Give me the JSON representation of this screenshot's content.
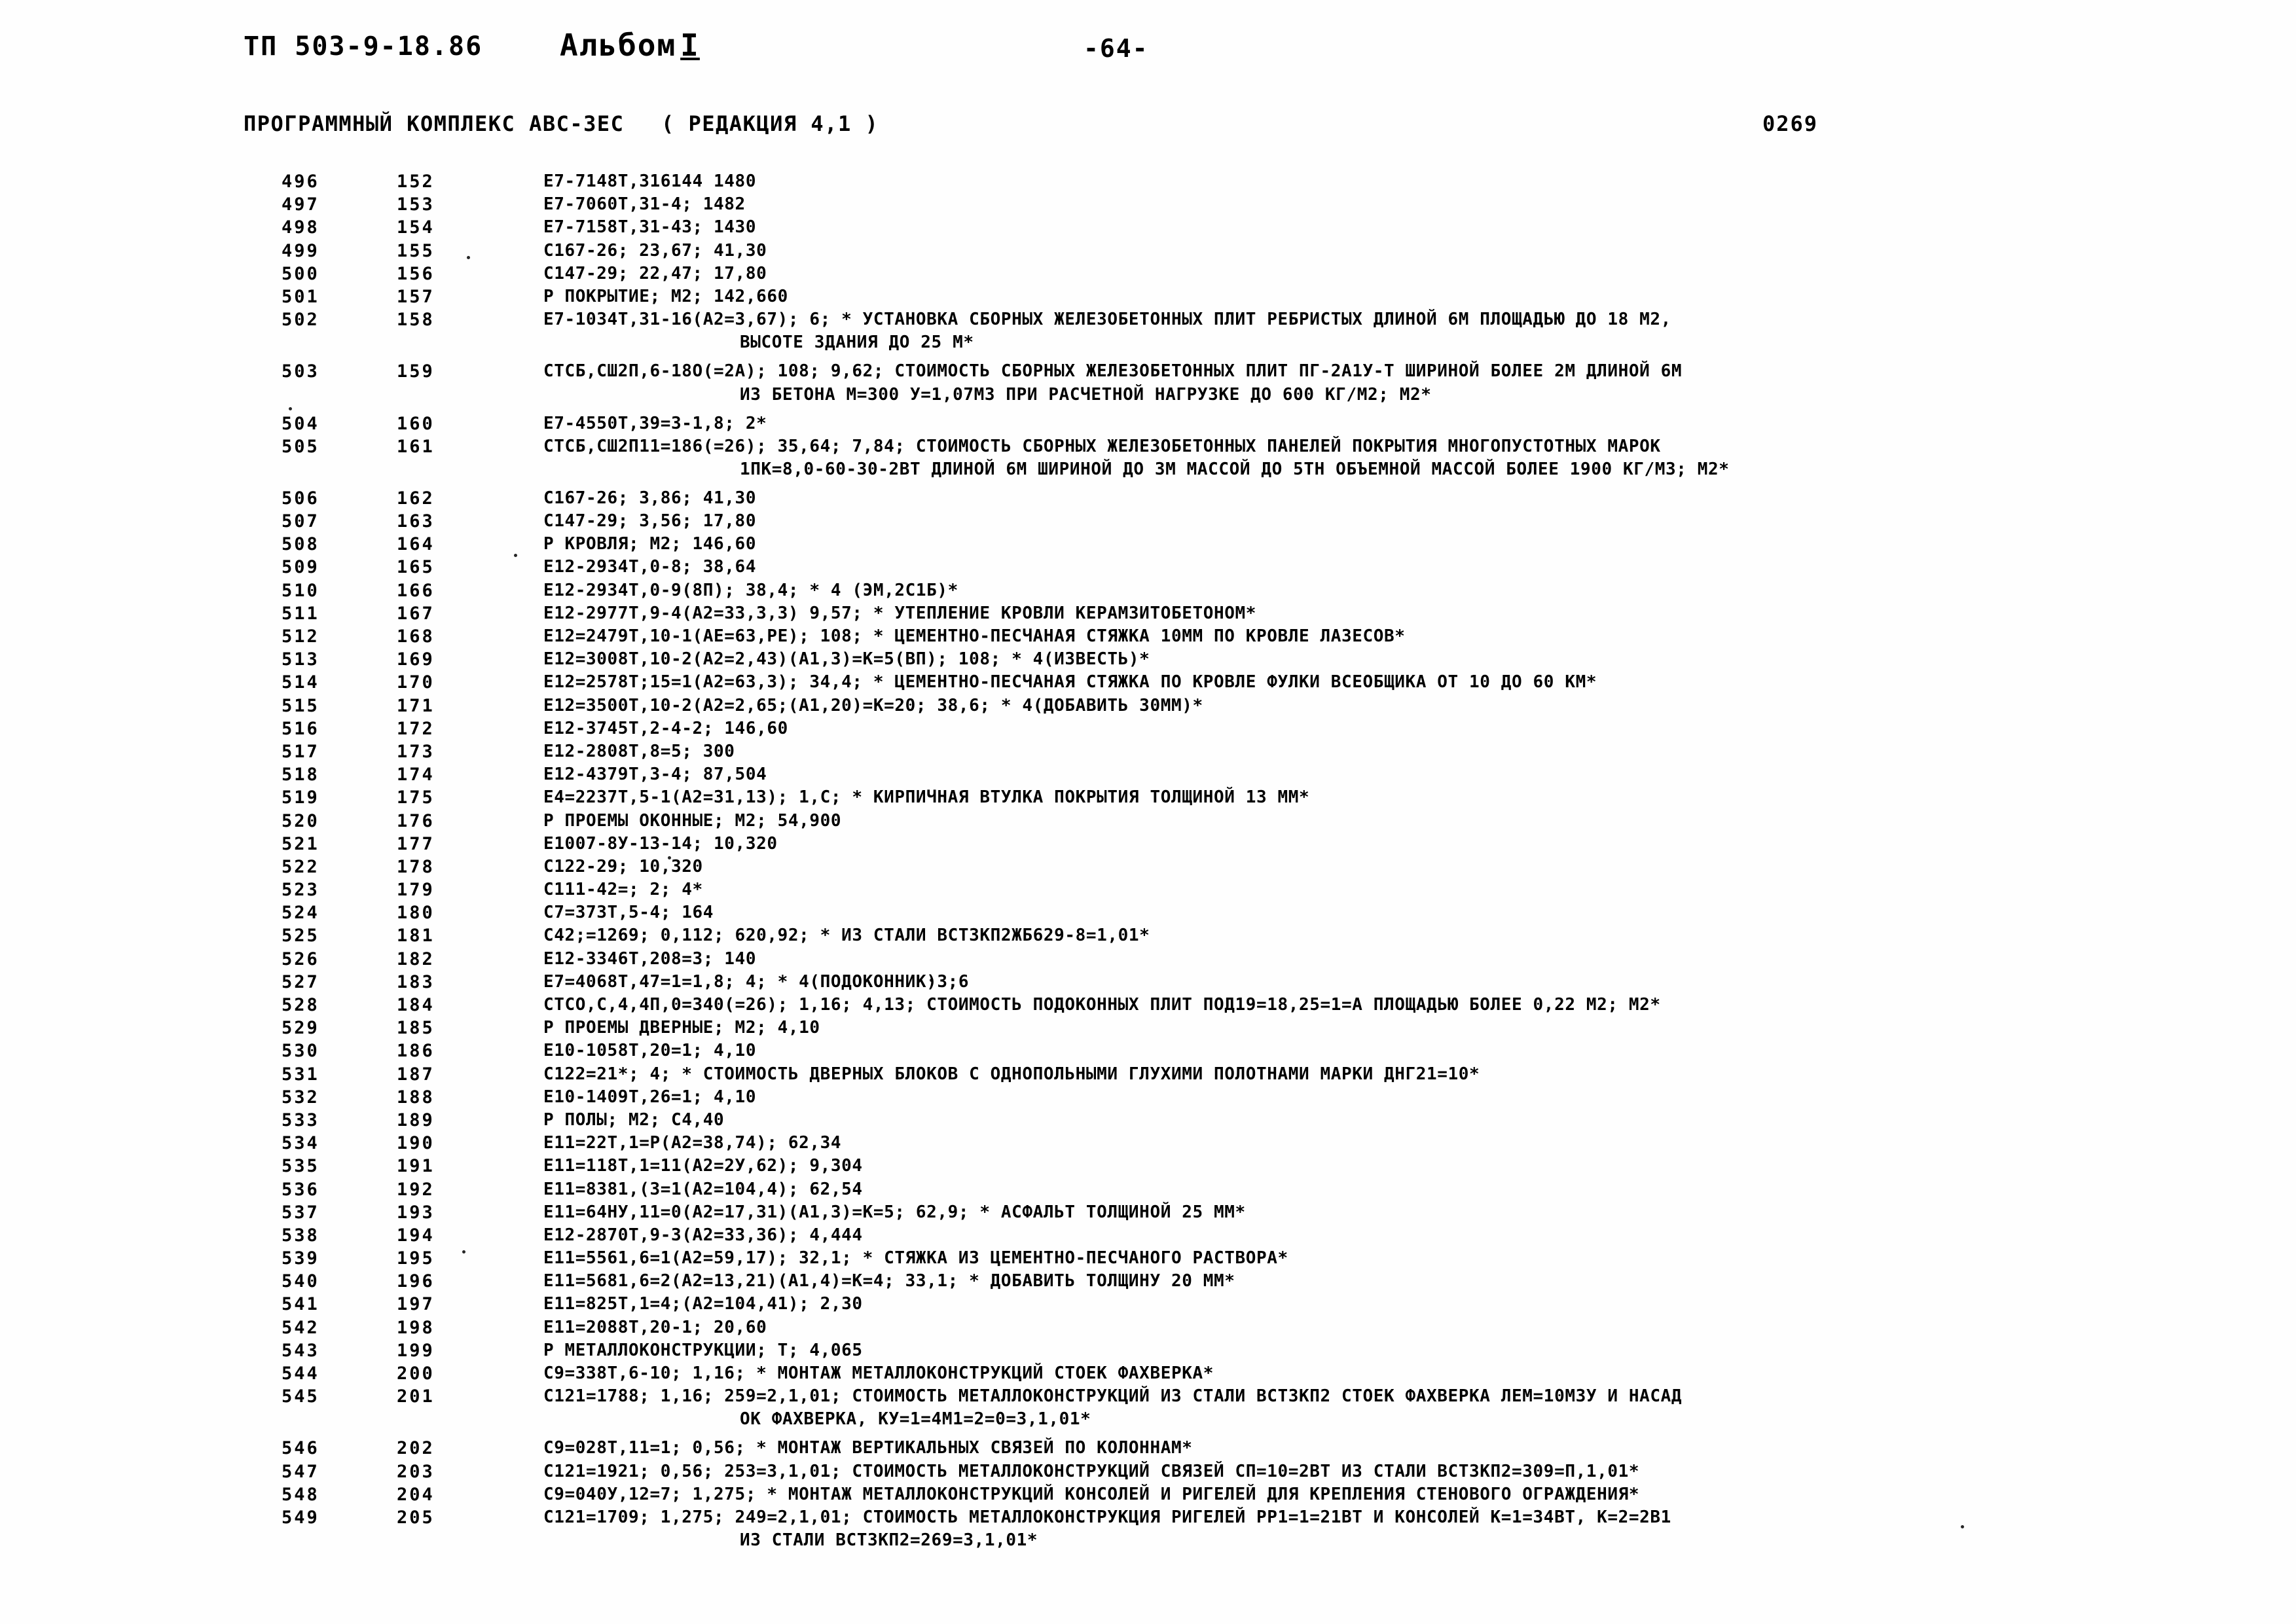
{
  "header": {
    "doc_code": "ТП 503-9-18.86",
    "album_label": "Альбом",
    "album_number": "I",
    "page_number": "-64-",
    "complex_title": "ПРОГРАММНЫЙ КОМПЛЕКС АВС-3ЕС",
    "redaction": "( РЕДАКЦИЯ 4,1 )",
    "sheet_code": "0269"
  },
  "listing": {
    "rows": [
      {
        "seq": "496",
        "idx": "152",
        "text": "Е7-7148Т,316144  1480",
        "cont": ""
      },
      {
        "seq": "497",
        "idx": "153",
        "text": "Е7-7060Т,31-4;  1482",
        "cont": ""
      },
      {
        "seq": "498",
        "idx": "154",
        "text": "Е7-7158Т,31-43;  1430",
        "cont": ""
      },
      {
        "seq": "499",
        "idx": "155",
        "text": "С167-26;  23,67;  41,30",
        "cont": ""
      },
      {
        "seq": "500",
        "idx": "156",
        "text": "С147-29;  22,47;  17,80",
        "cont": ""
      },
      {
        "seq": "501",
        "idx": "157",
        "text": "Р ПОКРЫТИЕ;  М2;  142,660",
        "cont": ""
      },
      {
        "seq": "502",
        "idx": "158",
        "text": "Е7-1034Т,31-16(А2=3,67);  6;  *   УСТАНОВКА СБОРНЫХ ЖЕЛЕЗОБЕТОННЫХ ПЛИТ РЕБРИСТЫХ ДЛИНОЙ 6М ПЛОЩАДЬЮ ДО 18 М2,",
        "cont": ""
      },
      {
        "seq": "",
        "idx": "",
        "text": "",
        "cont": "ВЫСОТЕ ЗДАНИЯ ДО 25 М*"
      },
      {
        "seq": "503",
        "idx": "159",
        "text": "СТСБ,СШ2П,6-18О(=2А);  108;  9,62;  СТОИМОСТЬ СБОРНЫХ ЖЕЛЕЗОБЕТОННЫХ ПЛИТ ПГ-2А1У-Т ШИРИНОЙ БОЛЕЕ 2М ДЛИНОЙ 6М",
        "cont": ""
      },
      {
        "seq": "",
        "idx": "",
        "text": "",
        "cont": "ИЗ БЕТОНА М=300 У=1,07М3 ПРИ РАСЧЕТНОЙ НАГРУЗКЕ ДО 600 КГ/М2;  М2*"
      },
      {
        "seq": "504",
        "idx": "160",
        "text": "Е7-4550Т,39=3-1,8;  2*",
        "cont": ""
      },
      {
        "seq": "505",
        "idx": "161",
        "text": "СТСБ,СШ2П11=186(=26);  35,64;  7,84;   СТОИМОСТЬ СБОРНЫХ ЖЕЛЕЗОБЕТОННЫХ ПАНЕЛЕЙ ПОКРЫТИЯ МНОГОПУСТОТНЫХ МАРОК",
        "cont": ""
      },
      {
        "seq": "",
        "idx": "",
        "text": "",
        "cont": "1ПК=8,0-60-30-2ВТ ДЛИНОЙ 6М ШИРИНОЙ ДО 3М МАССОЙ ДО 5ТН ОБЪЕМНОЙ МАССОЙ БОЛЕЕ 1900 КГ/М3;  М2*"
      },
      {
        "seq": "506",
        "idx": "162",
        "text": "С167-26;  3,86;  41,30",
        "cont": ""
      },
      {
        "seq": "507",
        "idx": "163",
        "text": "С147-29;  3,56;  17,80",
        "cont": ""
      },
      {
        "seq": "508",
        "idx": "164",
        "text": "Р КРОВЛЯ;  М2;  146,60",
        "cont": ""
      },
      {
        "seq": "509",
        "idx": "165",
        "text": "Е12-2934Т,0-8;  38,64",
        "cont": ""
      },
      {
        "seq": "510",
        "idx": "166",
        "text": "Е12-2934Т,0-9(8П);  38,4;  *  4 (ЭМ,2С1Б)*",
        "cont": ""
      },
      {
        "seq": "511",
        "idx": "167",
        "text": "Е12-2977Т,9-4(А2=33,3,3)  9,57;  *  УТЕПЛЕНИЕ КРОВЛИ КЕРАМЗИТОБЕТОНОМ*",
        "cont": ""
      },
      {
        "seq": "512",
        "idx": "168",
        "text": "Е12=2479Т,10-1(АЕ=63,РЕ);  108;  *  ЦЕМЕНТНО-ПЕСЧАНАЯ СТЯЖКА 10ММ ПО КРОВЛЕ ЛАЗЕСОВ*",
        "cont": ""
      },
      {
        "seq": "513",
        "idx": "169",
        "text": "Е12=3008Т,10-2(А2=2,43)(А1,3)=К=5(ВП);  108;  *  4(ИЗВЕСТЬ)*",
        "cont": ""
      },
      {
        "seq": "514",
        "idx": "170",
        "text": "Е12=2578Т;15=1(А2=63,3);  34,4;  *  ЦЕМЕНТНО-ПЕСЧАНАЯ СТЯЖКА ПО КРОВЛЕ ФУЛКИ ВСЕОБЩИКА ОТ 10 ДО 60 КМ*",
        "cont": ""
      },
      {
        "seq": "515",
        "idx": "171",
        "text": "Е12=3500Т,10-2(А2=2,65;(А1,20)=К=20;  38,6;  *  4(ДОБАВИТЬ 30ММ)*",
        "cont": ""
      },
      {
        "seq": "516",
        "idx": "172",
        "text": "Е12-3745Т,2-4-2;  146,60",
        "cont": ""
      },
      {
        "seq": "517",
        "idx": "173",
        "text": "Е12-2808Т,8=5;  300",
        "cont": ""
      },
      {
        "seq": "518",
        "idx": "174",
        "text": "Е12-4379Т,3-4;  87,504",
        "cont": ""
      },
      {
        "seq": "519",
        "idx": "175",
        "text": "Е4=2237Т,5-1(А2=31,13);  1,С;  *  КИРПИЧНАЯ ВТУЛКА ПОКРЫТИЯ ТОЛЩИНОЙ 13 ММ*",
        "cont": ""
      },
      {
        "seq": "520",
        "idx": "176",
        "text": "Р ПРОЕМЫ ОКОННЫЕ;  М2;  54,900",
        "cont": ""
      },
      {
        "seq": "521",
        "idx": "177",
        "text": "Е1007-8У-13-14;  10,320",
        "cont": ""
      },
      {
        "seq": "522",
        "idx": "178",
        "text": "С122-29;  10,320",
        "cont": ""
      },
      {
        "seq": "523",
        "idx": "179",
        "text": "С111-42=;  2;  4*",
        "cont": ""
      },
      {
        "seq": "524",
        "idx": "180",
        "text": "С7=373Т,5-4;  164",
        "cont": ""
      },
      {
        "seq": "525",
        "idx": "181",
        "text": "С42;=1269;  0,112;  620,92;  *  ИЗ СТАЛИ ВСТ3КП2ЖБ629-8=1,01*",
        "cont": ""
      },
      {
        "seq": "526",
        "idx": "182",
        "text": "Е12-3346Т,208=3;  140",
        "cont": ""
      },
      {
        "seq": "527",
        "idx": "183",
        "text": "Е7=4068Т,47=1=1,8;  4;  *  4(ПОДОКОННИК)3;6",
        "cont": ""
      },
      {
        "seq": "528",
        "idx": "184",
        "text": "СТСО,С,4,4П,0=340(=26);  1,16;  4,13;  СТОИМОСТЬ ПОДОКОННЫХ ПЛИТ ПОД19=18,25=1=А ПЛОЩАДЬЮ БОЛЕЕ 0,22 М2;  М2*",
        "cont": ""
      },
      {
        "seq": "529",
        "idx": "185",
        "text": "Р ПРОЕМЫ ДВЕРНЫЕ;  М2;  4,10",
        "cont": ""
      },
      {
        "seq": "530",
        "idx": "186",
        "text": "Е10-1058Т,20=1;  4,10",
        "cont": ""
      },
      {
        "seq": "531",
        "idx": "187",
        "text": "С122=21*;  4;  *  СТОИМОСТЬ ДВЕРНЫХ БЛОКОВ С ОДНОПОЛЬНЫМИ ГЛУХИМИ ПОЛОТНАМИ МАРКИ ДНГ21=10*",
        "cont": ""
      },
      {
        "seq": "532",
        "idx": "188",
        "text": "Е10-1409Т,26=1;  4,10",
        "cont": ""
      },
      {
        "seq": "533",
        "idx": "189",
        "text": "Р ПОЛЫ;  М2;  С4,40",
        "cont": ""
      },
      {
        "seq": "534",
        "idx": "190",
        "text": "Е11=22Т,1=Р(А2=38,74);  62,34",
        "cont": ""
      },
      {
        "seq": "535",
        "idx": "191",
        "text": "Е11=118Т,1=11(А2=2У,62);  9,304",
        "cont": ""
      },
      {
        "seq": "536",
        "idx": "192",
        "text": "Е11=8381,(3=1(А2=104,4);  62,54",
        "cont": ""
      },
      {
        "seq": "537",
        "idx": "193",
        "text": "Е11=64НУ,11=0(А2=17,31)(А1,3)=К=5;  62,9;  *  АСФАЛЬТ ТОЛЩИНОЙ 25 ММ*",
        "cont": ""
      },
      {
        "seq": "538",
        "idx": "194",
        "text": "Е12-2870Т,9-3(А2=33,36);  4,444",
        "cont": ""
      },
      {
        "seq": "539",
        "idx": "195",
        "text": "Е11=5561,6=1(А2=59,17);  32,1;  *  СТЯЖКА ИЗ ЦЕМЕНТНО-ПЕСЧАНОГО РАСТВОРА*",
        "cont": ""
      },
      {
        "seq": "540",
        "idx": "196",
        "text": "Е11=5681,6=2(А2=13,21)(А1,4)=К=4;  33,1;  *  ДОБАВИТЬ ТОЛЩИНУ 20 ММ*",
        "cont": ""
      },
      {
        "seq": "541",
        "idx": "197",
        "text": "Е11=825Т,1=4;(А2=104,41);  2,30",
        "cont": ""
      },
      {
        "seq": "542",
        "idx": "198",
        "text": "Е11=2088Т,20-1;  20,60",
        "cont": ""
      },
      {
        "seq": "543",
        "idx": "199",
        "text": "Р МЕТАЛЛОКОНСТРУКЦИИ;  Т;  4,065",
        "cont": ""
      },
      {
        "seq": "544",
        "idx": "200",
        "text": "С9=338Т,6-10;  1,16;  *  МОНТАЖ МЕТАЛЛОКОНСТРУКЦИЙ СТОЕК ФАХВЕРКА*",
        "cont": ""
      },
      {
        "seq": "545",
        "idx": "201",
        "text": "С121=1788;  1,16;  259=2,1,01;  СТОИМОСТЬ МЕТАЛЛОКОНСТРУКЦИЙ ИЗ СТАЛИ ВСТ3КП2 СТОЕК ФАХВЕРКА ЛЕМ=10М3У И НАСАД",
        "cont": ""
      },
      {
        "seq": "",
        "idx": "",
        "text": "",
        "cont": "ОК ФАХВЕРКА, КУ=1=4М1=2=0=3,1,01*"
      },
      {
        "seq": "546",
        "idx": "202",
        "text": "С9=028Т,11=1;  0,56;  *  МОНТАЖ ВЕРТИКАЛЬНЫХ СВЯЗЕЙ ПО КОЛОННАМ*",
        "cont": ""
      },
      {
        "seq": "547",
        "idx": "203",
        "text": "С121=1921;  0,56;  253=3,1,01;  СТОИМОСТЬ МЕТАЛЛОКОНСТРУКЦИЙ СВЯЗЕЙ СП=10=2ВТ ИЗ СТАЛИ ВСТ3КП2=309=П,1,01*",
        "cont": ""
      },
      {
        "seq": "548",
        "idx": "204",
        "text": "С9=040У,12=7;  1,275;  *  МОНТАЖ МЕТАЛЛОКОНСТРУКЦИЙ КОНСОЛЕЙ И РИГЕЛЕЙ ДЛЯ КРЕПЛЕНИЯ СТЕНОВОГО ОГРАЖДЕНИЯ*",
        "cont": ""
      },
      {
        "seq": "549",
        "idx": "205",
        "text": "С121=1709;  1,275;  249=2,1,01;  СТОИМОСТЬ МЕТАЛЛОКОНСТРУКЦИЯ РИГЕЛЕЙ РР1=1=21ВТ И КОНСОЛЕЙ К=1=34ВТ, К=2=2В1",
        "cont": ""
      },
      {
        "seq": "",
        "idx": "",
        "text": "",
        "cont": "ИЗ СТАЛИ ВСТ3КП2=269=3,1,01*"
      }
    ]
  }
}
